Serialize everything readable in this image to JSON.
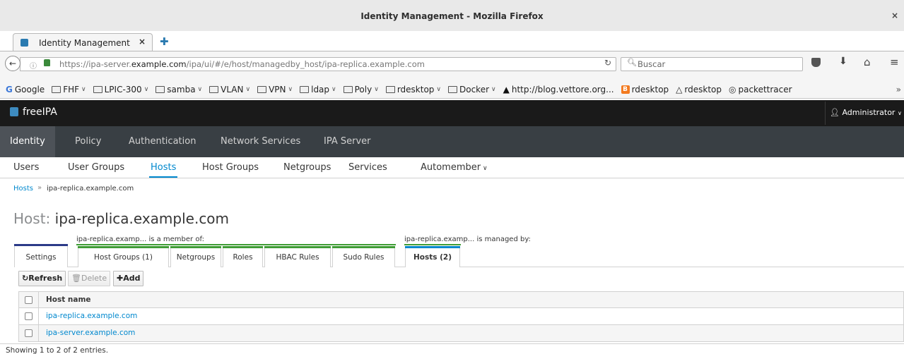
{
  "window": {
    "title": "Identity Management - Mozilla Firefox",
    "close_glyph": "×"
  },
  "browser": {
    "tab": {
      "title": "Identity Management",
      "close_glyph": "×"
    },
    "newtab_glyph": "✚",
    "url_prefix": "https://ipa-server.",
    "url_domain": "example.com",
    "url_suffix": "/ipa/ui/#/e/host/managedby_host/ipa-replica.example.com",
    "search_placeholder": "Buscar",
    "bookmarks": [
      {
        "label": "Google",
        "icon": "google-icon",
        "folder": false,
        "menu": false
      },
      {
        "label": "FHF",
        "icon": "folder-icon",
        "folder": true,
        "menu": true
      },
      {
        "label": "LPIC-300",
        "icon": "folder-icon",
        "folder": true,
        "menu": true
      },
      {
        "label": "samba",
        "icon": "folder-icon",
        "folder": true,
        "menu": true
      },
      {
        "label": "VLAN",
        "icon": "folder-icon",
        "folder": true,
        "menu": true
      },
      {
        "label": "VPN",
        "icon": "folder-icon",
        "folder": true,
        "menu": true
      },
      {
        "label": "ldap",
        "icon": "folder-icon",
        "folder": true,
        "menu": true
      },
      {
        "label": "Poly",
        "icon": "folder-icon",
        "folder": true,
        "menu": true
      },
      {
        "label": "rdesktop",
        "icon": "folder-icon",
        "folder": true,
        "menu": true
      },
      {
        "label": "Docker",
        "icon": "folder-icon",
        "folder": true,
        "menu": true
      },
      {
        "label": "http://blog.vettore.org...",
        "icon": "arch-icon",
        "folder": false,
        "menu": false
      },
      {
        "label": "rdesktop",
        "icon": "blogger-icon",
        "folder": false,
        "menu": false
      },
      {
        "label": "rdesktop",
        "icon": "tux-icon",
        "folder": false,
        "menu": false
      },
      {
        "label": "packettracer",
        "icon": "globe-icon",
        "folder": false,
        "menu": false
      }
    ],
    "bookmarks_more": "»"
  },
  "app": {
    "brand": "freeIPA",
    "user": "Administrator",
    "top_nav": [
      "Identity",
      "Policy",
      "Authentication",
      "Network Services",
      "IPA Server"
    ],
    "top_nav_active": 0,
    "sub_nav": [
      "Users",
      "User Groups",
      "Hosts",
      "Host Groups",
      "Netgroups",
      "Services",
      "Automember"
    ],
    "sub_nav_active": 2,
    "breadcrumb": {
      "parent": "Hosts",
      "separator": "»",
      "current": "ipa-replica.example.com"
    },
    "page": {
      "label": "Host:",
      "name": "ipa-replica.example.com"
    },
    "facet_groups": {
      "member_of": "ipa-replica.examp... is a member of:",
      "managed_by": "ipa-replica.examp... is managed by:"
    },
    "facets": {
      "settings": "Settings",
      "member_of": [
        "Host Groups (1)",
        "Netgroups",
        "Roles",
        "HBAC Rules",
        "Sudo Rules"
      ],
      "managed_by": "Hosts (2)"
    },
    "toolbar": {
      "refresh": "Refresh",
      "delete": "Delete",
      "add": "Add"
    },
    "table": {
      "column": "Host name",
      "rows": [
        "ipa-replica.example.com",
        "ipa-server.example.com"
      ],
      "footer": "Showing 1 to 2 of 2 entries."
    }
  },
  "colors": {
    "accent": "#0088ce",
    "group_line": "#3f9c35",
    "settings_line": "#2b3a88",
    "header_bg": "#1a1a1a",
    "nav_bg": "#393f44"
  }
}
